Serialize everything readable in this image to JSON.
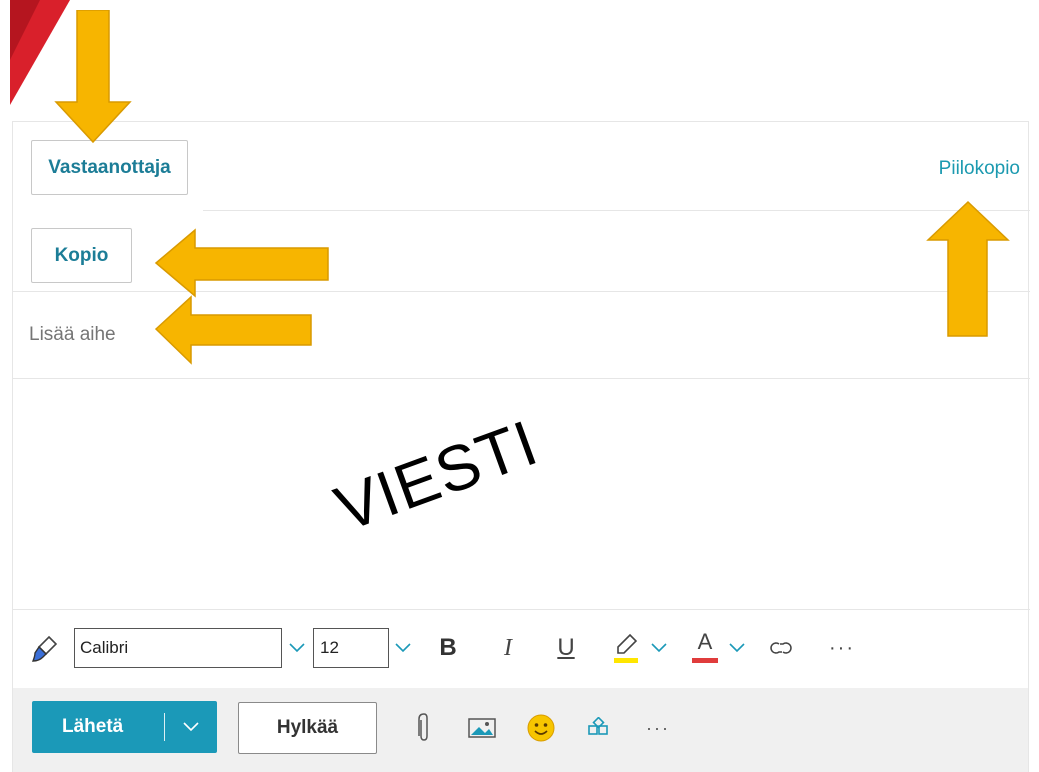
{
  "recipients": {
    "to_label": "Vastaanottaja",
    "cc_label": "Kopio",
    "bcc_label": "Piilokopio"
  },
  "subject": {
    "placeholder": "Lisää aihe"
  },
  "body": {
    "annotation_text": "VIESTI"
  },
  "formatting": {
    "font_name": "Calibri",
    "font_size": "12",
    "bold_label": "B",
    "italic_label": "I",
    "underline_label": "U",
    "font_color_label": "A",
    "more_label": "···"
  },
  "actions": {
    "send_label": "Lähetä",
    "discard_label": "Hylkää",
    "more_label": "···"
  },
  "colors": {
    "accent": "#1b99b8",
    "link": "#1c7d97",
    "arrow_fill": "#f7b500",
    "highlight_bar": "#ffe600",
    "font_color_bar": "#e03c3c",
    "brand_red": "#d9202b"
  },
  "icons": [
    "paint-brush-icon",
    "chevron-down-icon",
    "highlighter-icon",
    "font-color-icon",
    "link-icon",
    "attach-icon",
    "image-icon",
    "emoji-icon",
    "apps-icon"
  ]
}
